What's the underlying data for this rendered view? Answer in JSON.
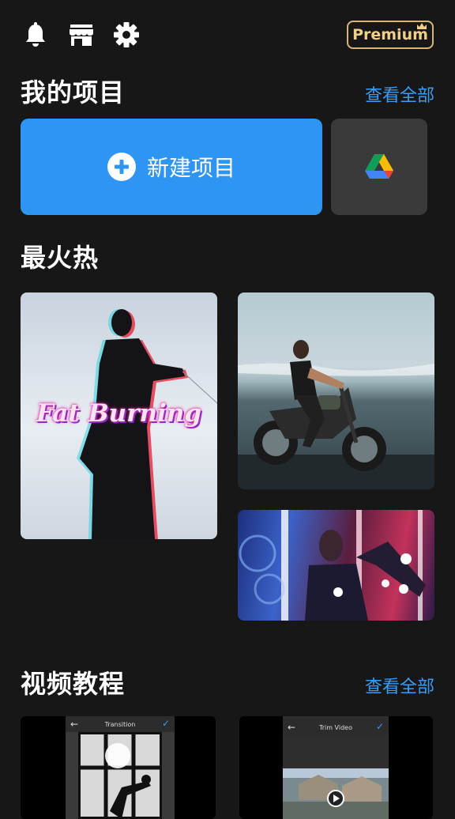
{
  "header": {
    "premium_label": "Premium",
    "icons": [
      "bell-icon",
      "store-icon",
      "gear-icon",
      "crown-icon"
    ]
  },
  "my_projects": {
    "title": "我的项目",
    "view_all": "查看全部",
    "new_project_label": "新建项目"
  },
  "hot": {
    "title": "最火热",
    "cards": [
      {
        "overlay_text": "Fat Burning"
      },
      {},
      {}
    ]
  },
  "tutorials": {
    "title": "视频教程",
    "view_all": "查看全部",
    "cards": [
      {
        "label": "Transition"
      },
      {
        "label": "Trim Video"
      }
    ]
  },
  "colors": {
    "background": "#171717",
    "accent": "#2f95f3",
    "link": "#3b9cf3",
    "premium": "#d9b574"
  }
}
